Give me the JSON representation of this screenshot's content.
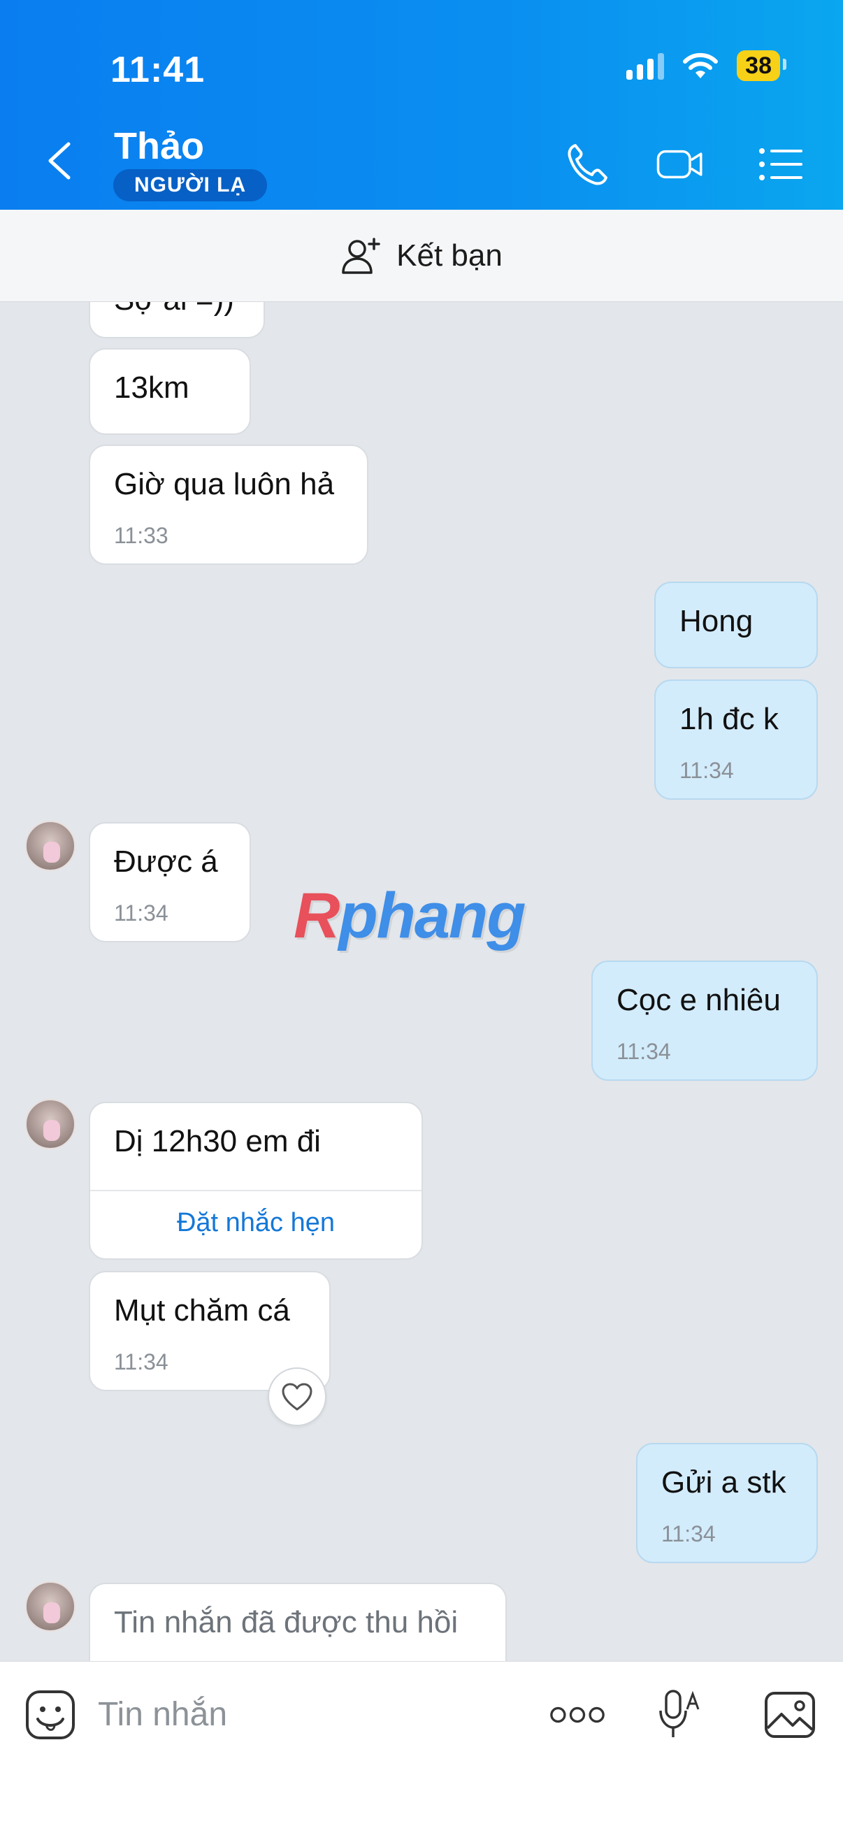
{
  "status_bar": {
    "time": "11:41",
    "battery": "38"
  },
  "header": {
    "contact_name": "Thảo",
    "badge": "NGƯỜI LẠ"
  },
  "add_friend": {
    "label": "Kết bạn"
  },
  "messages": [
    {
      "side": "in",
      "text": "Sợ ai =))",
      "time": ""
    },
    {
      "side": "in",
      "text": "13km",
      "time": ""
    },
    {
      "side": "in",
      "text": "Giờ qua luôn hả",
      "time": "11:33"
    },
    {
      "side": "out",
      "text": "Hong",
      "time": ""
    },
    {
      "side": "out",
      "text": "1h đc k",
      "time": "11:34"
    },
    {
      "side": "in",
      "text": "Được á",
      "time": "11:34"
    },
    {
      "side": "out",
      "text": "Cọc e nhiêu",
      "time": "11:34"
    },
    {
      "side": "in",
      "text": "Dị 12h30 em đi",
      "time": "",
      "action": "Đặt nhắc hẹn"
    },
    {
      "side": "in",
      "text": "Mụt chăm cá",
      "time": "11:34"
    },
    {
      "side": "out",
      "text": "Gửi a stk",
      "time": "11:34"
    },
    {
      "side": "in",
      "text": "Tin nhắn đã được thu hồi",
      "time": ""
    }
  ],
  "watermark": {
    "part1": "R",
    "part2": "phang"
  },
  "input": {
    "placeholder": "Tin nhắn"
  }
}
